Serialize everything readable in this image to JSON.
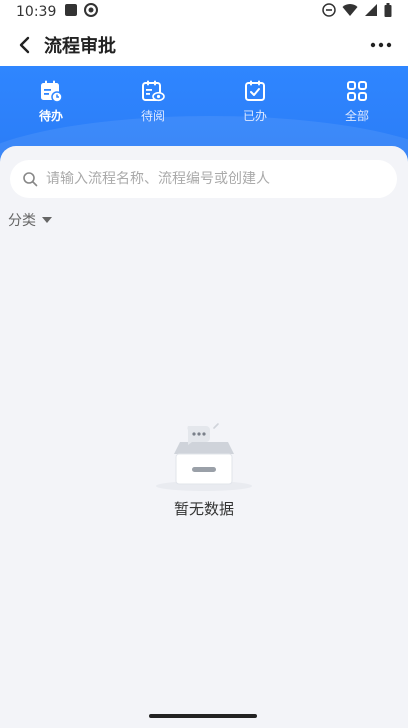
{
  "status_bar": {
    "time": "10:39"
  },
  "header": {
    "title": "流程审批"
  },
  "tabs": [
    {
      "label": "待办",
      "icon": "calendar-clock-icon",
      "active": true
    },
    {
      "label": "待阅",
      "icon": "calendar-eye-icon",
      "active": false
    },
    {
      "label": "已办",
      "icon": "calendar-check-icon",
      "active": false
    },
    {
      "label": "全部",
      "icon": "grid-icon",
      "active": false
    }
  ],
  "search": {
    "placeholder": "请输入流程名称、流程编号或创建人",
    "value": ""
  },
  "filter": {
    "category_label": "分类"
  },
  "empty": {
    "text": "暂无数据"
  },
  "colors": {
    "primary": "#2f86ff",
    "background": "#f3f4f8"
  }
}
